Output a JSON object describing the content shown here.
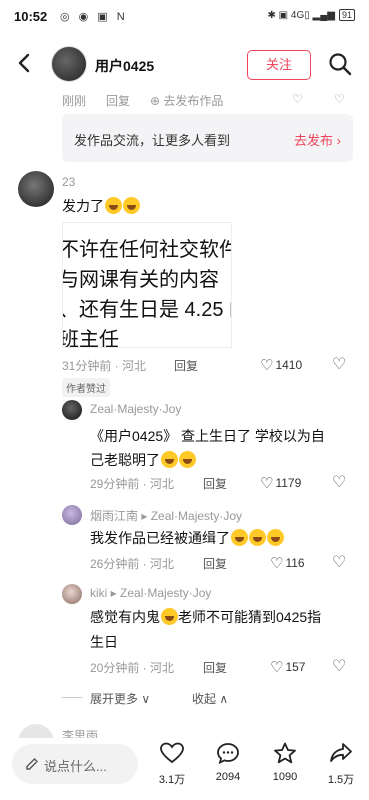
{
  "status": {
    "time": "10:52",
    "icons": "◎ ◉ ▣ N",
    "right": "✱ ▣ 4G▯ ▂▄▆",
    "battery": "91"
  },
  "header": {
    "username": "用户0425",
    "follow_label": "关注"
  },
  "prev_row": {
    "time": "刚刚",
    "reply": "回复",
    "publish": "去发布作品"
  },
  "banner": {
    "text": "发作品交流，让更多人看到",
    "action": "去发布 ›"
  },
  "comment": {
    "username": "23",
    "text": "发力了",
    "image_lines": [
      "不许在任何社交软件",
      "与网课有关的内容",
      "、还有生日是 4.25 的",
      "班主任"
    ],
    "time": "31分钟前 · 河北",
    "reply": "回复",
    "likes": "1410",
    "author_tag": "作者赞过"
  },
  "replies": [
    {
      "username": "Zeal·Majesty·Joy",
      "text": "《用户0425》 查上生日了 学校以为自",
      "text2": "己老聪明了",
      "time": "29分钟前 · 河北",
      "reply": "回复",
      "likes": "1179"
    },
    {
      "username": "烟雨江南 ▸ Zeal·Majesty·Joy",
      "text": "我发作品已经被通缉了",
      "time": "26分钟前 · 河北",
      "reply": "回复",
      "likes": "116"
    },
    {
      "username": "kiki ▸ Zeal·Majesty·Joy",
      "text": "感觉有内鬼",
      "text_b": "老师不可能猜到0425指",
      "text2": "生日",
      "time": "20分钟前 · 河北",
      "reply": "回复",
      "likes": "157"
    }
  ],
  "expand": {
    "more": "展开更多 ∨",
    "collapse": "收起 ∧"
  },
  "next_user": "李思雨",
  "bottom": {
    "placeholder": "说点什么...",
    "likes": "3.1万",
    "comments": "2094",
    "favorites": "1090",
    "shares": "1.5万"
  }
}
